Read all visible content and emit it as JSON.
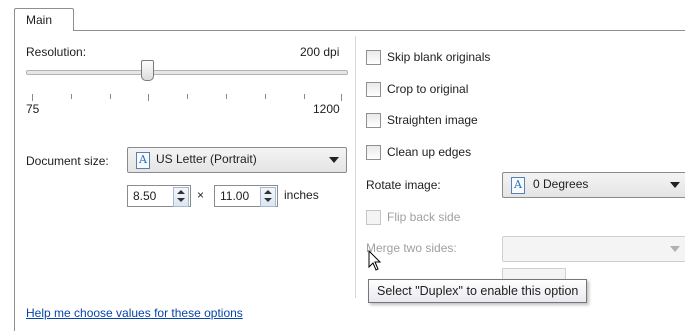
{
  "tabs": [
    {
      "label": "Main"
    }
  ],
  "resolution": {
    "label": "Resolution:",
    "value_text": "200 dpi",
    "min_label": "75",
    "max_label": "1200",
    "value": 200,
    "min": 75,
    "max": 1200
  },
  "document_size": {
    "label": "Document size:",
    "selected": "US Letter (Portrait)",
    "width": "8.50",
    "height": "11.00",
    "times": "×",
    "unit": "inches"
  },
  "options": {
    "skip_blank": {
      "label": "Skip blank originals",
      "checked": false
    },
    "crop": {
      "label": "Crop to original",
      "checked": false
    },
    "straighten": {
      "label": "Straighten image",
      "checked": false
    },
    "clean_edges": {
      "label": "Clean up edges",
      "checked": false
    },
    "rotate": {
      "label": "Rotate image:",
      "selected": "0 Degrees"
    },
    "flip_back": {
      "label": "Flip back side",
      "checked": false,
      "enabled": false
    },
    "merge": {
      "label": "Merge two sides:",
      "selected": "",
      "enabled": false
    }
  },
  "help_link": "Help me choose values for these options",
  "tooltip": "Select \"Duplex\" to enable this option",
  "colors": {
    "link": "#0645ad",
    "disabled": "#a0a0a0",
    "tooltip_border": "#767676"
  }
}
